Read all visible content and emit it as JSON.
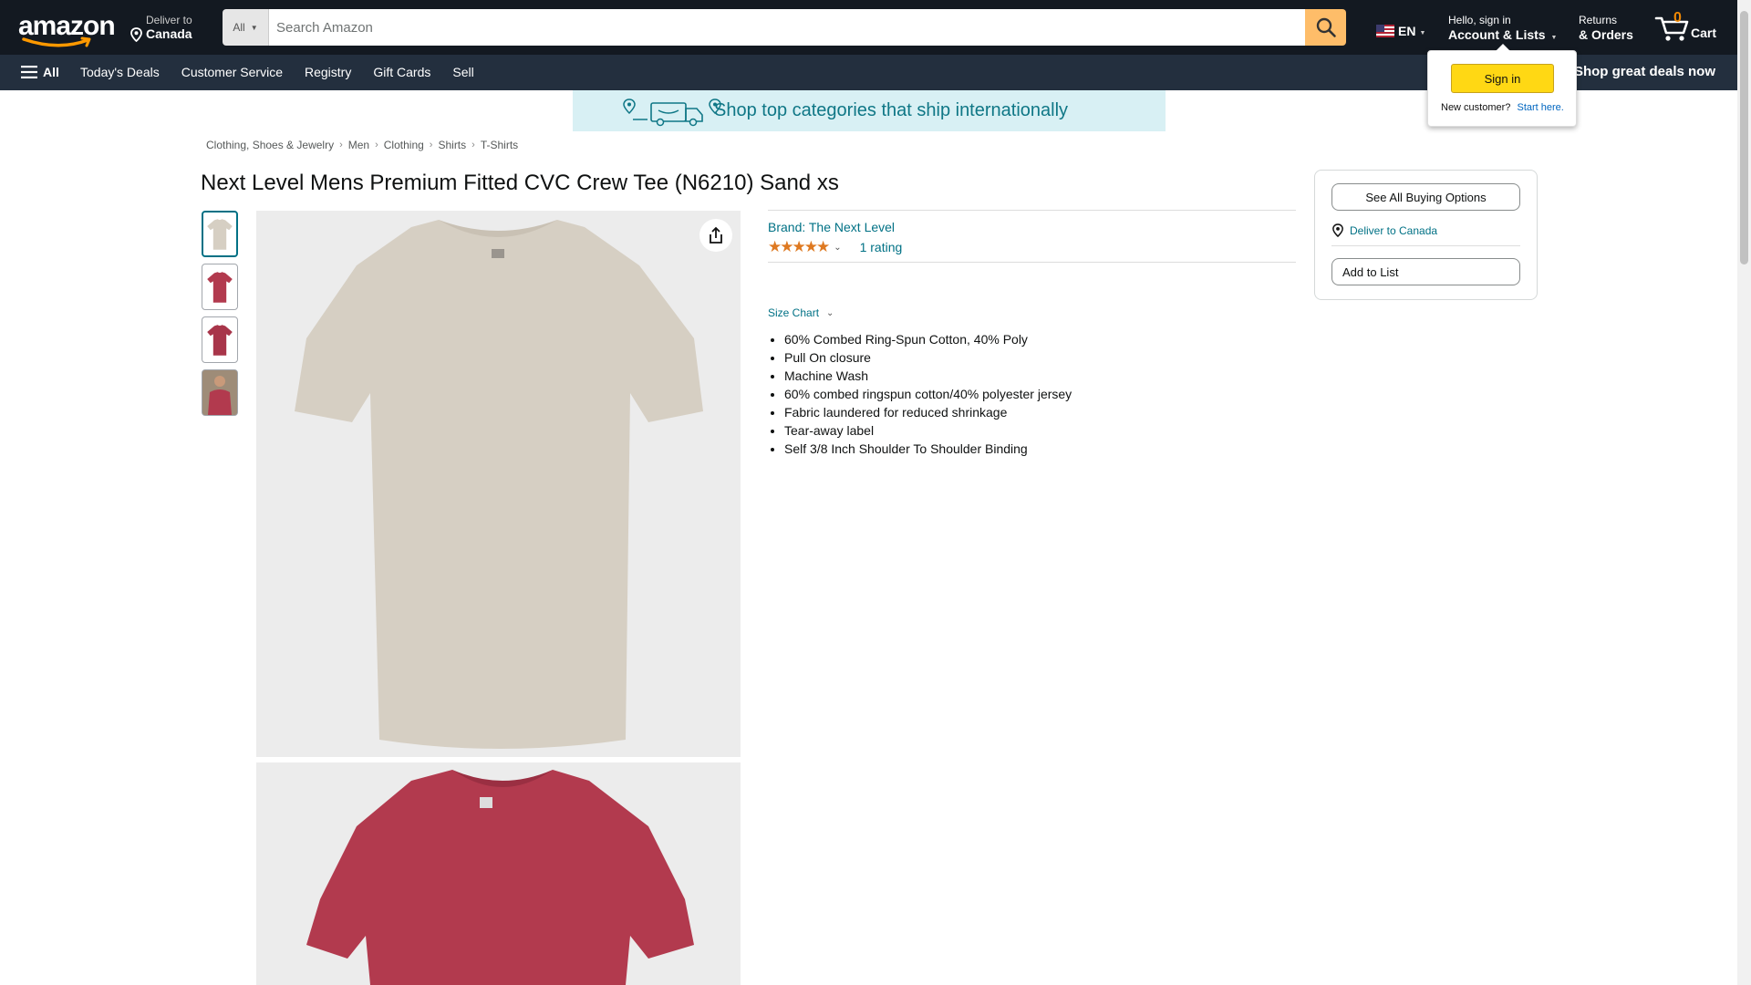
{
  "header": {
    "logo_text": "amazon",
    "deliver_line1": "Deliver to",
    "deliver_line2": "Canada",
    "search": {
      "department": "All",
      "placeholder": "Search Amazon"
    },
    "language": "EN",
    "account_line1": "Hello, sign in",
    "account_line2": "Account & Lists",
    "orders_line1": "Returns",
    "orders_line2": "& Orders",
    "cart_count": "0",
    "cart_label": "Cart"
  },
  "subnav": {
    "all_label": "All",
    "links": [
      "Today's Deals",
      "Customer Service",
      "Registry",
      "Gift Cards",
      "Sell"
    ],
    "promo": "Shop great deals now"
  },
  "flyout": {
    "signin_label": "Sign in",
    "new_customer": "New customer?",
    "start_here": "Start here."
  },
  "banner": {
    "text": "Shop top categories that ship internationally"
  },
  "breadcrumb": [
    "Clothing, Shoes & Jewelry",
    "Men",
    "Clothing",
    "Shirts",
    "T-Shirts"
  ],
  "product": {
    "title": "Next Level Mens Premium Fitted CVC Crew Tee (N6210) Sand xs",
    "brand": "Brand: The Next Level",
    "stars": "★★★★★",
    "rating_count": "1 rating",
    "size_chart": "Size Chart",
    "bullets": [
      "60% Combed Ring-Spun Cotton, 40% Poly",
      "Pull On closure",
      "Machine Wash",
      "60% combed ringspun cotton/40% polyester jersey",
      "Fabric laundered for reduced shrinkage",
      "Tear-away label",
      "Self 3/8 Inch Shoulder To Shoulder Binding"
    ],
    "colors": {
      "sand": "#d6cfc3",
      "cardinal": "#b23a4e"
    }
  },
  "buybox": {
    "see_all": "See All Buying Options",
    "deliver_to": "Deliver to Canada",
    "add_to_list": "Add to List"
  },
  "theme": {
    "header_bg": "#131921",
    "subnav_bg": "#232f3e",
    "accent_orange": "#febd69",
    "link_teal": "#007185",
    "star_color": "#de7921"
  }
}
